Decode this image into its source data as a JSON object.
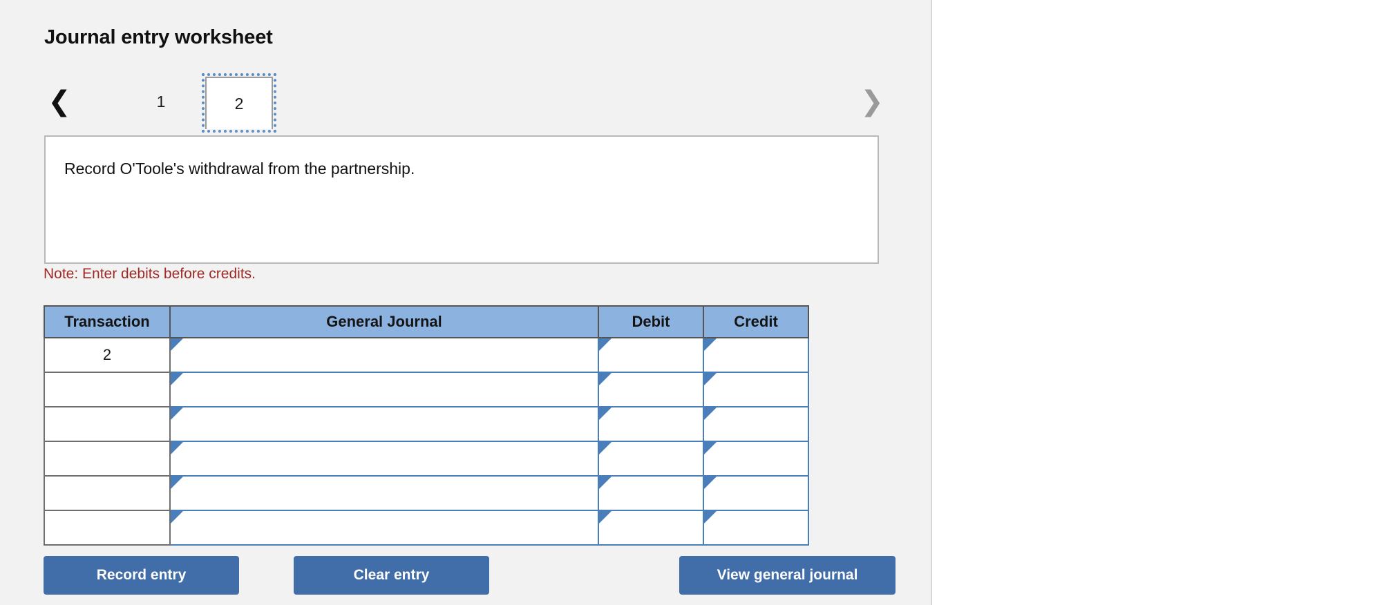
{
  "page": {
    "title": "Journal entry worksheet"
  },
  "tabs": {
    "prev_icon": "chevron-left-icon",
    "next_icon": "chevron-right-icon",
    "items": [
      {
        "label": "1",
        "active": false
      },
      {
        "label": "2",
        "active": true
      }
    ]
  },
  "description": {
    "text": "Record O'Toole's withdrawal from the partnership."
  },
  "note": {
    "text": "Note: Enter debits before credits."
  },
  "table": {
    "headers": {
      "transaction": "Transaction",
      "general_journal": "General Journal",
      "debit": "Debit",
      "credit": "Credit"
    },
    "rows": [
      {
        "transaction": "2",
        "general_journal": "",
        "debit": "",
        "credit": ""
      },
      {
        "transaction": "",
        "general_journal": "",
        "debit": "",
        "credit": ""
      },
      {
        "transaction": "",
        "general_journal": "",
        "debit": "",
        "credit": ""
      },
      {
        "transaction": "",
        "general_journal": "",
        "debit": "",
        "credit": ""
      },
      {
        "transaction": "",
        "general_journal": "",
        "debit": "",
        "credit": ""
      },
      {
        "transaction": "",
        "general_journal": "",
        "debit": "",
        "credit": ""
      }
    ]
  },
  "buttons": {
    "record": "Record entry",
    "clear": "Clear entry",
    "view": "View general journal"
  },
  "colors": {
    "panel_background": "#f2f2f2",
    "header_blue": "#8cb2e0",
    "button_blue": "#416da9",
    "note_red": "#9e2a25",
    "select_border": "#4a7ebb"
  }
}
